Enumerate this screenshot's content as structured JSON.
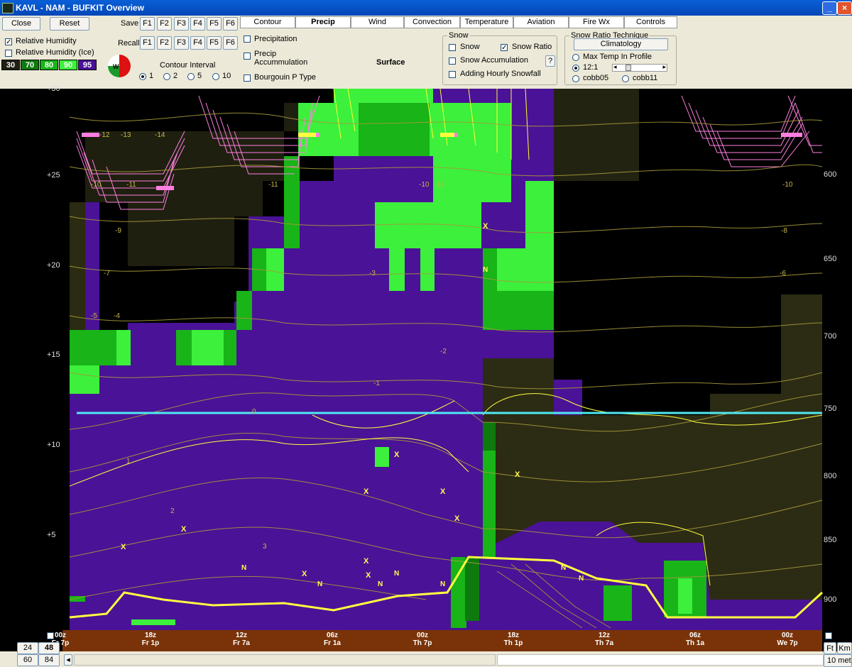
{
  "window": {
    "title": "KAVL - NAM - BUFKIT Overview"
  },
  "left_panel": {
    "close_label": "Close",
    "reset_label": "Reset",
    "save_label": "Save",
    "recall_label": "Recall",
    "fkeys": [
      "F1",
      "F2",
      "F3",
      "F4",
      "F5",
      "F6"
    ],
    "rh_label": "Relative Humidity",
    "rh_ice_label": "Relative Humidity (Ice)",
    "rh_legend": [
      "30",
      "70",
      "80",
      "90",
      "95"
    ],
    "rh_colors": [
      "#1f1f12",
      "#0e7a0e",
      "#18b418",
      "#3cf03c",
      "#4a1296"
    ],
    "contour_title": "Contour Interval",
    "contour_options": [
      "1",
      "2",
      "5",
      "10"
    ],
    "contour_selected": "1"
  },
  "tabs": [
    "Contour",
    "Precip",
    "Wind",
    "Convection",
    "Temperature",
    "Aviation",
    "Fire Wx",
    "Controls"
  ],
  "active_tab": "Precip",
  "precip": {
    "precipitation_label": "Precipitation",
    "precip_acc_label_1": "Precip",
    "precip_acc_label_2": "Accummulation",
    "bourgouin_label": "Bourgouin P Type",
    "surface_label": "Surface"
  },
  "snow": {
    "title": "Snow",
    "snow_label": "Snow",
    "snow_ratio_label": "Snow Ratio",
    "snow_acc_label": "Snow Accumulation",
    "help_label": "?",
    "hourly_label": "Adding Hourly Snowfall"
  },
  "snow_ratio": {
    "title": "Snow Ratio Technique",
    "climatology_label": "Climatology",
    "max_temp_label": "Max Temp In Profile",
    "ratio_label": "12:1",
    "cobb05_label": "cobb05",
    "cobb11_label": "cobb11"
  },
  "y_axis_left": [
    "+30",
    "+25",
    "+20",
    "+15",
    "+10",
    "+5"
  ],
  "y_axis_right": [
    "600",
    "650",
    "700",
    "750",
    "800",
    "850",
    "900"
  ],
  "time_axis": [
    {
      "top": "00z",
      "bottom": "Fr 7p"
    },
    {
      "top": "18z",
      "bottom": "Fr 1p"
    },
    {
      "top": "12z",
      "bottom": "Fr 7a"
    },
    {
      "top": "06z",
      "bottom": "Fr 1a"
    },
    {
      "top": "00z",
      "bottom": "Th 7p"
    },
    {
      "top": "18z",
      "bottom": "Th 1p"
    },
    {
      "top": "12z",
      "bottom": "Th 7a"
    },
    {
      "top": "06z",
      "bottom": "Th 1a"
    },
    {
      "top": "00z",
      "bottom": "We 7p"
    }
  ],
  "bottom": {
    "hours": [
      "24",
      "48",
      "60",
      "84"
    ],
    "selected_hours": "48",
    "ft_label": "Ft",
    "km_label": "Km",
    "height_label": "10 met"
  },
  "chart_labels": {
    "temps": [
      "-12",
      "-13",
      "-14",
      "-10",
      "-11",
      "-11",
      "-10",
      "-11",
      "-10",
      "-9",
      "-8",
      "-7",
      "-6",
      "-5",
      "-4",
      "-3",
      "-2",
      "-1",
      "0",
      "1",
      "2",
      "3"
    ],
    "symbols": [
      "X",
      "N"
    ]
  }
}
